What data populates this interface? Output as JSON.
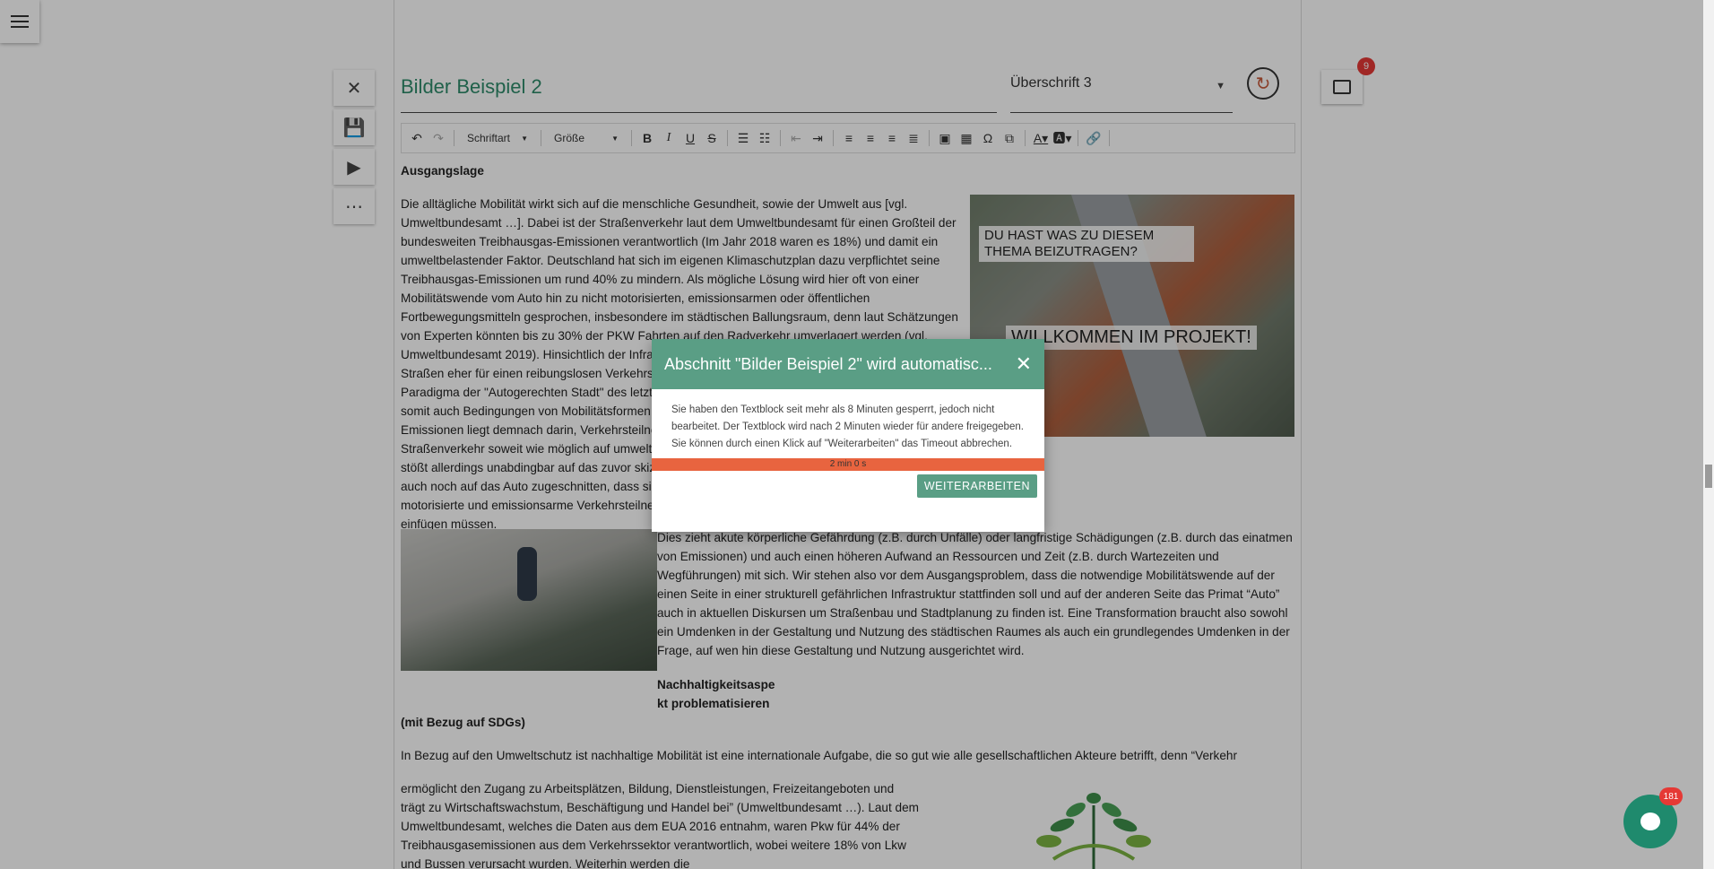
{
  "title": "Bilder Beispiel 2",
  "style_select": "Überschrift 3",
  "comments_badge": "9",
  "toolbar": {
    "font": "Schriftart",
    "size": "Größe"
  },
  "content": {
    "heading1": "Ausgangslage",
    "para1": "Die alltägliche Mobilität wirkt sich auf die menschliche Gesundheit, sowie der Umwelt aus [vgl. Umweltbundesamt …]. Dabei ist der Straßenverkehr laut dem Umweltbundesamt für einen Großteil der bundesweiten Treibhausgas-Emissionen verantwortlich (Im Jahr 2018 waren es 18%) und damit ein umweltbelastender Faktor. Deutschland hat sich im eigenen Klimaschutzplan dazu verpflichtet seine Treibhausgas-Emissionen um rund 40% zu mindern. Als mögliche Lösung wird hier oft von einer Mobilitätswende vom Auto hin zu nicht motorisierten, emissionsarmen oder öffentlichen Fortbewegungsmitteln gesprochen, insbesondere im städtischen Ballungsraum, denn laut Schätzungen von Experten könnten bis zu 30% der PKW Fahrten auf den Radverkehr umverlagert werden (vgl. Umweltbundesamt 2019). Hinsichtlich der Infrastruktur von Städten wirkt es allerdings so, als seien Straßen eher für einen reibungslosen Verkehrsfluss von Autofahrenden ausgelegt, das städtebauliche Paradigma der \"Autogerechten Stadt\" des letzten Jahrhunderts prägt primär das urbane Straßenbild und somit auch Bedingungen von Mobilitätsformen. Ein erklärtes Ziel der Minderung der Treibhausgas-Emissionen liegt demnach darin, Verkehrsteilnehmende vom bestehenden PKW- lastigen Straßenverkehr soweit wie möglich auf umweltschonendere Alternativen zu lenken. Dieses Postulat stößt allerdings unabdingbar auf das zuvor skizzierte Spannungsverhältnis: Die Stadt ist und wird oft auch noch auf das Auto zugeschnitten, dass sich Fahrradfahrende, Fußgänger*innen und andere nicht motorisierte und emissionsarme Verkehrsteilnehmer*innen in den strukturell privilegierten Autoverkehr einfügen müssen.",
    "para2": "Dies zieht akute körperliche Gefährdung (z.B. durch Unfälle) oder langfristige Schädigungen (z.B. durch das einatmen von Emissionen) und auch einen höheren Aufwand an Ressourcen und Zeit (z.B. durch Wartezeiten und Wegführungen) mit sich. Wir stehen also vor dem Ausgangsproblem, dass die notwendige Mobilitätswende auf der einen Seite in einer strukturell gefährlichen Infrastruktur stattfinden soll und auf der anderen Seite das Primat “Auto” auch in aktuellen Diskursen um Straßenbau und Stadtplanung zu finden ist. Eine Transformation braucht also sowohl ein Umdenken in der Gestaltung und Nutzung des städtischen Raumes als auch ein grundlegendes Umdenken in der Frage, auf wen hin diese Gestaltung und Nutzung ausgerichtet wird.",
    "heading2_a": "Nachhaltigkeitsaspe",
    "heading2_b": "kt problematisieren",
    "heading2_c": "(mit Bezug auf SDGs)",
    "para3": "In Bezug auf den Umweltschutz ist nachhaltige Mobilität ist eine internationale Aufgabe, die so gut wie alle gesellschaftlichen Akteure betrifft, denn “Verkehr",
    "para4": "ermöglicht den Zugang zu Arbeitsplätzen, Bildung, Dienstleistungen, Freizeitangeboten und trägt zu Wirtschaftswachstum, Beschäftigung und Handel bei” (Umweltbundesamt …). Laut dem Umweltbundesamt, welches die Daten aus dem EUA 2016 entnahm, waren Pkw für 44% der Treibhausgasemissionen aus dem Verkehrssektor verantwortlich, wobei weitere 18% von Lkw und Bussen verursacht wurden. Weiterhin werden die"
  },
  "image_captions": {
    "cap1": "DU HAST WAS ZU DIESEM THEMA BEIZUTRAGEN?",
    "cap2": "WILLKOMMEN IM PROJEKT!"
  },
  "dialog": {
    "title": "Abschnitt \"Bilder Beispiel 2\" wird automatisc...",
    "message": "Sie haben den Textblock seit mehr als 8 Minuten gesperrt, jedoch nicht bearbeitet. Der Textblock wird nach 2 Minuten wieder für andere freigegeben. Sie können durch einen Klick auf \"Weiterarbeiten\" das Timeout abbrechen.",
    "timer": "2 min 0 s",
    "progress": 1.0,
    "button": "WEITERARBEITEN"
  },
  "chat_badge": "181",
  "colors": {
    "accent": "#5a9e85",
    "title": "#2e8b6b",
    "progress": "#e8643f",
    "badge": "#e53935",
    "fab": "#1f8a6d"
  }
}
